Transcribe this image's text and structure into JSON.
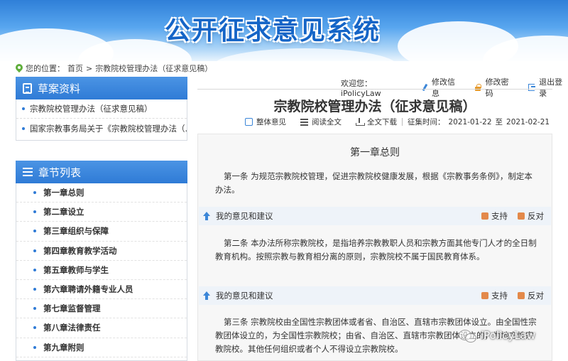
{
  "banner": {
    "title": "公开征求意见系统"
  },
  "breadcrumb": {
    "label": "您的位置：",
    "home": "首页",
    "sep": ">",
    "current": "宗教院校管理办法（征求意见稿）"
  },
  "user": {
    "welcome": "欢迎您：iPolicyLaw",
    "edit_info": "修改信息",
    "change_password": "修改密码",
    "logout": "退出登录"
  },
  "drafts": {
    "title": "草案资料",
    "items": [
      {
        "label": "宗教院校管理办法（征求意见稿）"
      },
      {
        "label": "国家宗教事务局关于《宗教院校管理办法（..."
      }
    ]
  },
  "chapters": {
    "title": "章节列表",
    "items": [
      {
        "label": "第一章总则"
      },
      {
        "label": "第二章设立"
      },
      {
        "label": "第三章组织与保障"
      },
      {
        "label": "第四章教育教学活动"
      },
      {
        "label": "第五章教师与学生"
      },
      {
        "label": "第六章聘请外籍专业人员"
      },
      {
        "label": "第七章监督管理"
      },
      {
        "label": "第八章法律责任"
      },
      {
        "label": "第九章附则"
      }
    ]
  },
  "document": {
    "title": "宗教院校管理办法（征求意见稿）",
    "toolbar": {
      "overall_opinion": "整体意见",
      "read_full": "阅读全文",
      "download_full": "全文下载",
      "period_label": "征集时间：",
      "start_date": "2021-01-22",
      "to": "至",
      "end_date": "2021-02-21"
    },
    "chapter_title": "第一章总则",
    "articles": [
      {
        "text": "第一条 为规范宗教院校管理，促进宗教院校健康发展，根据《宗教事务条例》，制定本办法。"
      },
      {
        "text": "第二条 本办法所称宗教院校，是指培养宗教教职人员和宗教方面其他专门人才的全日制教育机构。按照宗教与教育相分离的原则，宗教院校不属于国民教育体系。"
      },
      {
        "text": "第三条 宗教院校由全国性宗教团体或者省、自治区、直辖市宗教团体设立。由全国性宗教团体设立的，为全国性宗教院校；由省、自治区、直辖市宗教团体设立的，为地方性宗教院校。其他任何组织或者个人不得设立宗教院校。"
      }
    ],
    "suggestion": {
      "label": "我的意见和建议",
      "support": "支持",
      "oppose": "反对"
    }
  },
  "watermark": {
    "text": "iPolicyLaw"
  }
}
